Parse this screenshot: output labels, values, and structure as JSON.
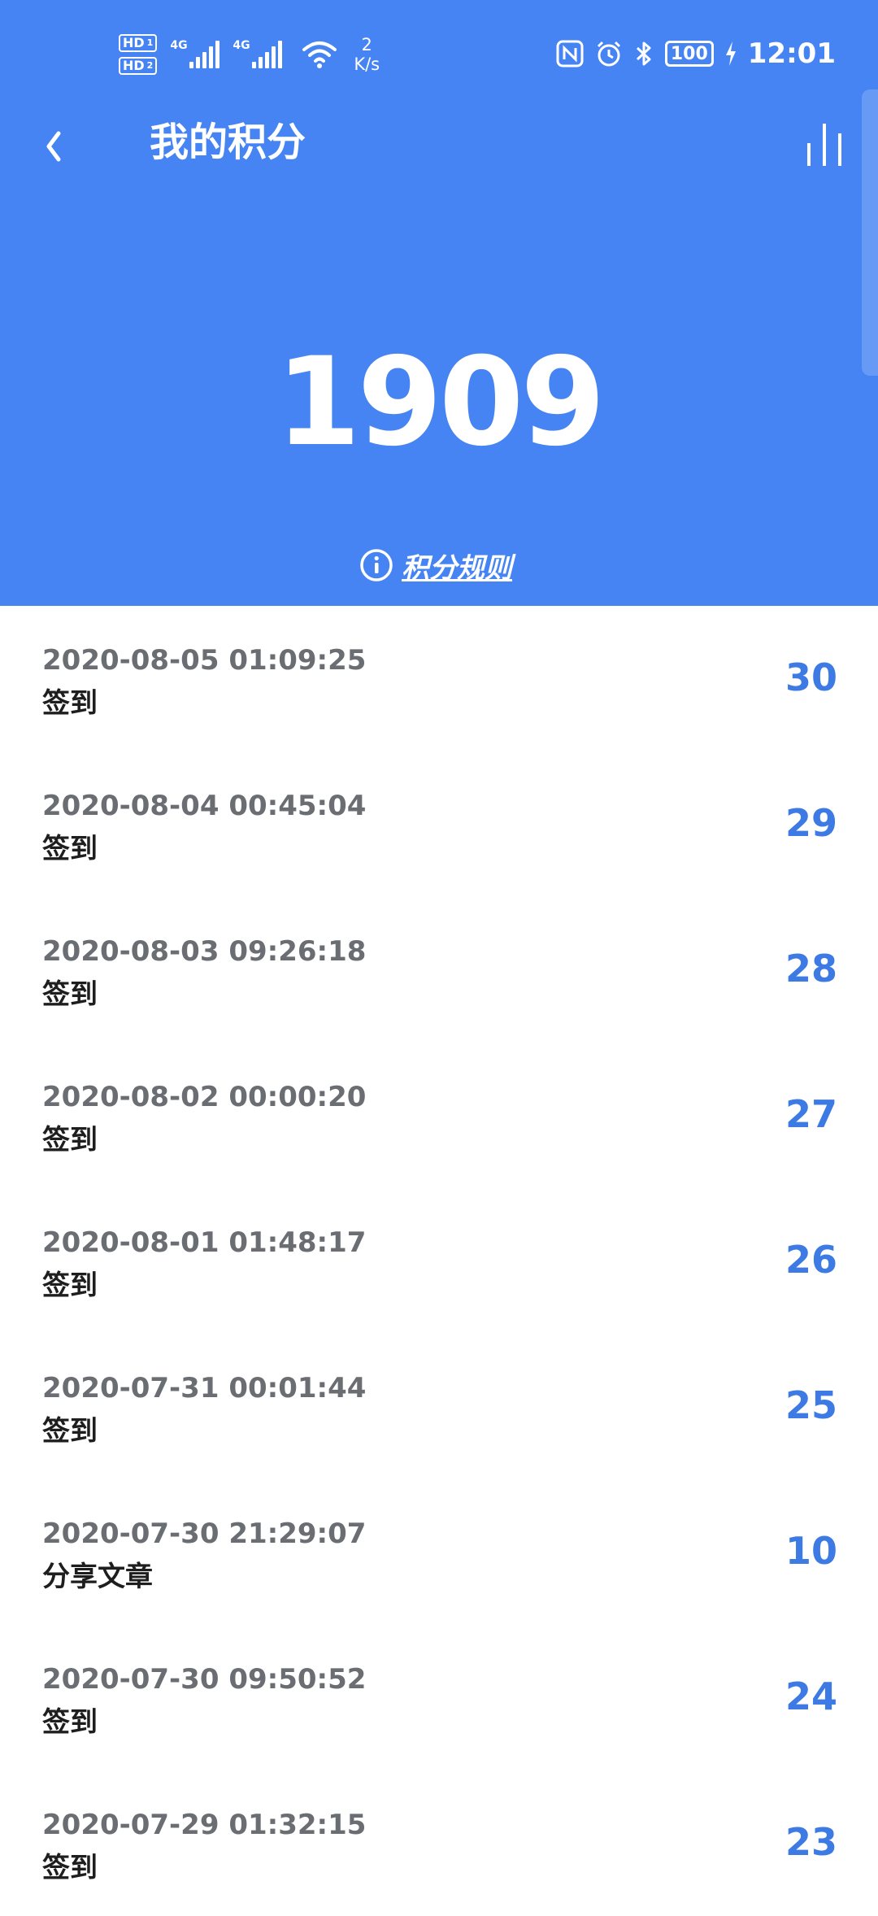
{
  "status_bar": {
    "hd1": "HD",
    "hd1_sim": "1",
    "hd2": "HD",
    "hd2_sim": "2",
    "network1": "4G",
    "network2": "4G",
    "speed_value": "2",
    "speed_unit": "K/s",
    "battery": "100",
    "time": "12:01"
  },
  "header": {
    "title": "我的积分",
    "total_points": "1909",
    "rules_link": "积分规则",
    "bg_color": "#4584f2"
  },
  "records": [
    {
      "time": "2020-08-05 01:09:25",
      "desc": "签到",
      "points": "30"
    },
    {
      "time": "2020-08-04 00:45:04",
      "desc": "签到",
      "points": "29"
    },
    {
      "time": "2020-08-03 09:26:18",
      "desc": "签到",
      "points": "28"
    },
    {
      "time": "2020-08-02 00:00:20",
      "desc": "签到",
      "points": "27"
    },
    {
      "time": "2020-08-01 01:48:17",
      "desc": "签到",
      "points": "26"
    },
    {
      "time": "2020-07-31 00:01:44",
      "desc": "签到",
      "points": "25"
    },
    {
      "time": "2020-07-30 21:29:07",
      "desc": "分享文章",
      "points": "10"
    },
    {
      "time": "2020-07-30 09:50:52",
      "desc": "签到",
      "points": "24"
    },
    {
      "time": "2020-07-29 01:32:15",
      "desc": "签到",
      "points": "23"
    }
  ],
  "icons": {
    "back": "back-arrow-icon",
    "chart": "bar-chart-icon",
    "info": "info-icon",
    "nfc": "nfc-icon",
    "alarm": "alarm-icon",
    "bluetooth": "bluetooth-icon",
    "wifi": "wifi-icon",
    "charging": "charging-icon"
  },
  "colors": {
    "accent": "#4584f2",
    "points": "#3d7ae3",
    "time_text": "#6a6d72"
  }
}
